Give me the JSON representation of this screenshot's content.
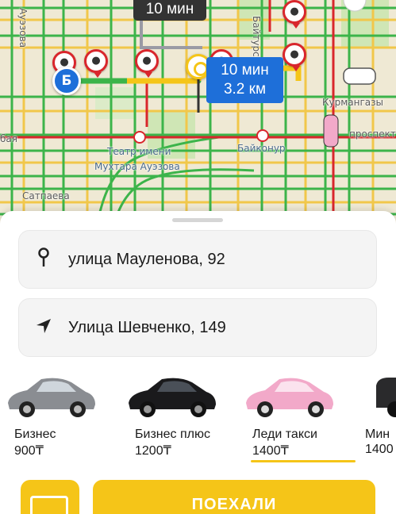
{
  "map": {
    "time_top": "10 мин",
    "route_time": "10 мин",
    "route_distance": "3.2 км",
    "point_b_label": "Б",
    "streets": {
      "auezova": "Ауэзова",
      "baytursynov": "Байтурсынов",
      "kurmangazy": "Курмангазы",
      "prospect": "проспект",
      "baya": "бая",
      "satpaeva": "Сатпаева",
      "baikonur": "Байконур",
      "teatr_line1": "Театр имени",
      "teatr_line2": "Мухтара Ауэзова"
    },
    "metro_label": "M"
  },
  "addresses": {
    "from": "улица Мауленова, 92",
    "to": "Улица Шевченко, 149"
  },
  "tariffs": [
    {
      "name": "Бизнес",
      "price": "900₸",
      "color": "#8a8d92"
    },
    {
      "name": "Бизнес плюс",
      "price": "1200₸",
      "color": "#1a1a1c"
    },
    {
      "name": "Леди такси",
      "price": "1400₸",
      "color": "#f2a9c9"
    },
    {
      "name": "Мин",
      "price": "1400",
      "color": "#2a2a2c"
    }
  ],
  "selected_tariff": 2,
  "actions": {
    "go_label": "ПОЕХАЛИ"
  },
  "colors": {
    "accent": "#f5c518",
    "route_blue": "#1e6fd9",
    "traffic_green": "#3cb44a",
    "traffic_red": "#d9262c"
  }
}
